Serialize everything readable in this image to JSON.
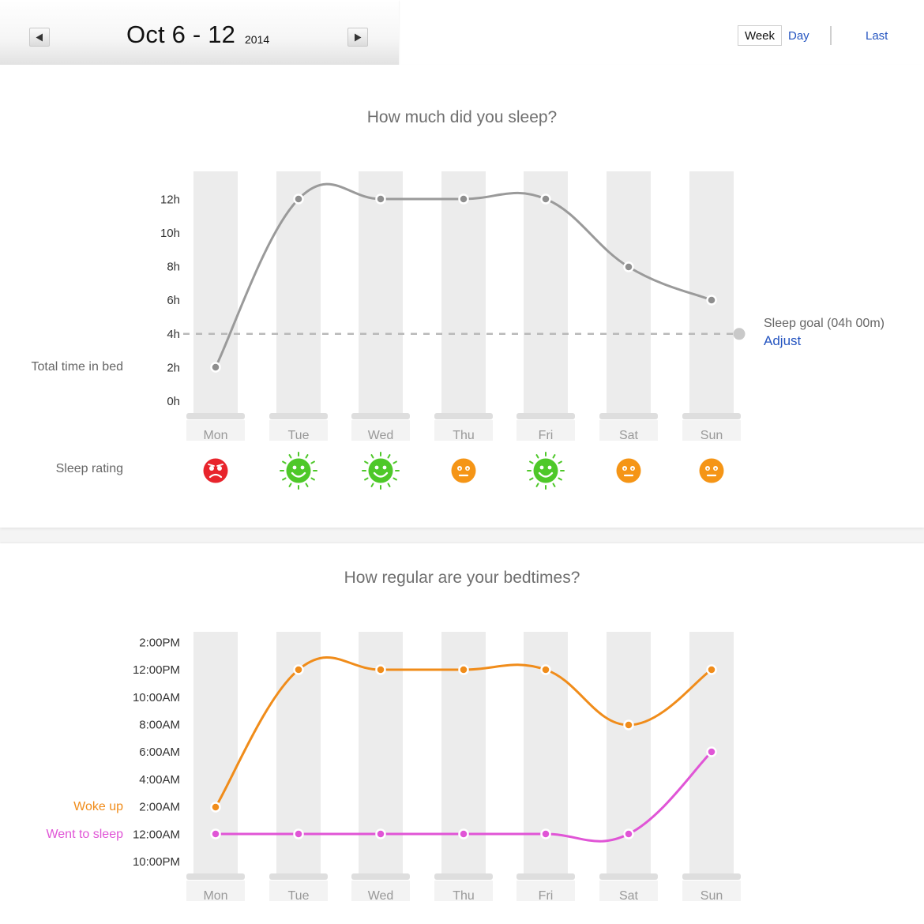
{
  "header": {
    "date_range": "Oct 6 - 12",
    "year": "2014",
    "view_week": "Week",
    "view_day": "Day",
    "last_link": "Last"
  },
  "colors": {
    "sleep_line": "#9a9a9a",
    "woke_line": "#f08c1a",
    "slept_line": "#e055d6",
    "link": "#2454c0",
    "rating_bad": "#e8242c",
    "rating_good": "#4ec829",
    "rating_ok": "#f59516"
  },
  "sleep_section": {
    "title": "How much did you sleep?",
    "total_label": "Total time in bed",
    "rating_label": "Sleep rating",
    "goal_label": "Sleep goal (04h 00m)",
    "adjust_label": "Adjust",
    "goal_value": 4,
    "ratings": [
      {
        "day": "Mon",
        "rating": "bad",
        "icon": "sad-face-icon"
      },
      {
        "day": "Tue",
        "rating": "good",
        "icon": "happy-face-icon"
      },
      {
        "day": "Wed",
        "rating": "good",
        "icon": "happy-face-icon"
      },
      {
        "day": "Thu",
        "rating": "ok",
        "icon": "neutral-face-icon"
      },
      {
        "day": "Fri",
        "rating": "good",
        "icon": "happy-face-icon"
      },
      {
        "day": "Sat",
        "rating": "ok",
        "icon": "neutral-face-icon"
      },
      {
        "day": "Sun",
        "rating": "ok",
        "icon": "neutral-face-icon"
      }
    ]
  },
  "bedtime_section": {
    "title": "How regular are your bedtimes?",
    "woke_label": "Woke up",
    "slept_label": "Went to sleep"
  },
  "chart_data": [
    {
      "type": "line",
      "title": "How much did you sleep?",
      "categories": [
        "Mon",
        "Tue",
        "Wed",
        "Thu",
        "Fri",
        "Sat",
        "Sun"
      ],
      "y_ticks": [
        "0h",
        "2h",
        "4h",
        "6h",
        "8h",
        "10h",
        "12h"
      ],
      "ylim": [
        0,
        12
      ],
      "goal_line": 4,
      "series": [
        {
          "name": "Total time in bed",
          "values": [
            2,
            12,
            12,
            12,
            12,
            8,
            6
          ]
        }
      ]
    },
    {
      "type": "line",
      "title": "How regular are your bedtimes?",
      "categories": [
        "Mon",
        "Tue",
        "Wed",
        "Thu",
        "Fri",
        "Sat",
        "Sun"
      ],
      "y_ticks": [
        "10:00PM",
        "12:00AM",
        "2:00AM",
        "4:00AM",
        "6:00AM",
        "8:00AM",
        "10:00AM",
        "12:00PM",
        "2:00PM"
      ],
      "series": [
        {
          "name": "Woke up",
          "values": [
            "2:00AM",
            "12:00PM",
            "12:00PM",
            "12:00PM",
            "12:00PM",
            "8:00AM",
            "12:00PM"
          ]
        },
        {
          "name": "Went to sleep",
          "values": [
            "12:00AM",
            "12:00AM",
            "12:00AM",
            "12:00AM",
            "12:00AM",
            "12:00AM",
            "6:00AM"
          ]
        }
      ]
    }
  ]
}
